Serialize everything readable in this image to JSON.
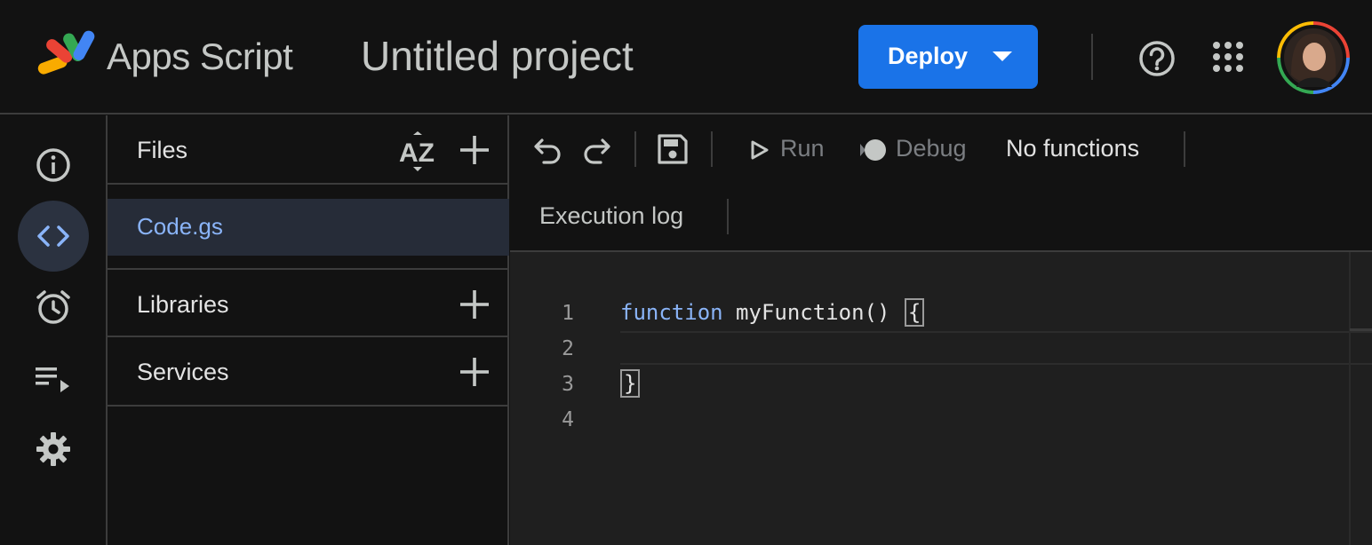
{
  "header": {
    "app_name": "Apps Script",
    "project_title": "Untitled project",
    "deploy_label": "Deploy",
    "help_icon": "help-circle-icon",
    "apps_icon": "apps-grid-icon"
  },
  "nav_rail": {
    "items": [
      {
        "name": "overview",
        "icon": "info-icon",
        "active": false
      },
      {
        "name": "editor",
        "icon": "code-icon",
        "active": true
      },
      {
        "name": "triggers",
        "icon": "alarm-icon",
        "active": false
      },
      {
        "name": "executions",
        "icon": "playlist-play-icon",
        "active": false
      },
      {
        "name": "settings",
        "icon": "gear-icon",
        "active": false
      }
    ]
  },
  "files_panel": {
    "title": "Files",
    "sort_icon_text": "AZ",
    "files": [
      {
        "name": "Code.gs",
        "selected": true
      }
    ],
    "libraries_label": "Libraries",
    "services_label": "Services"
  },
  "toolbar": {
    "run_label": "Run",
    "debug_label": "Debug",
    "function_select": "No functions",
    "execution_log_label": "Execution log"
  },
  "editor": {
    "line_numbers": [
      "1",
      "2",
      "3",
      "4"
    ],
    "keyword": "function",
    "line1_rest": " myFunction() ",
    "open_brace": "{",
    "close_brace": "}"
  },
  "colors": {
    "accent": "#1a73e8",
    "keyword": "#8ab4f8",
    "background": "#121212",
    "editor_background": "#1f1f1f"
  }
}
